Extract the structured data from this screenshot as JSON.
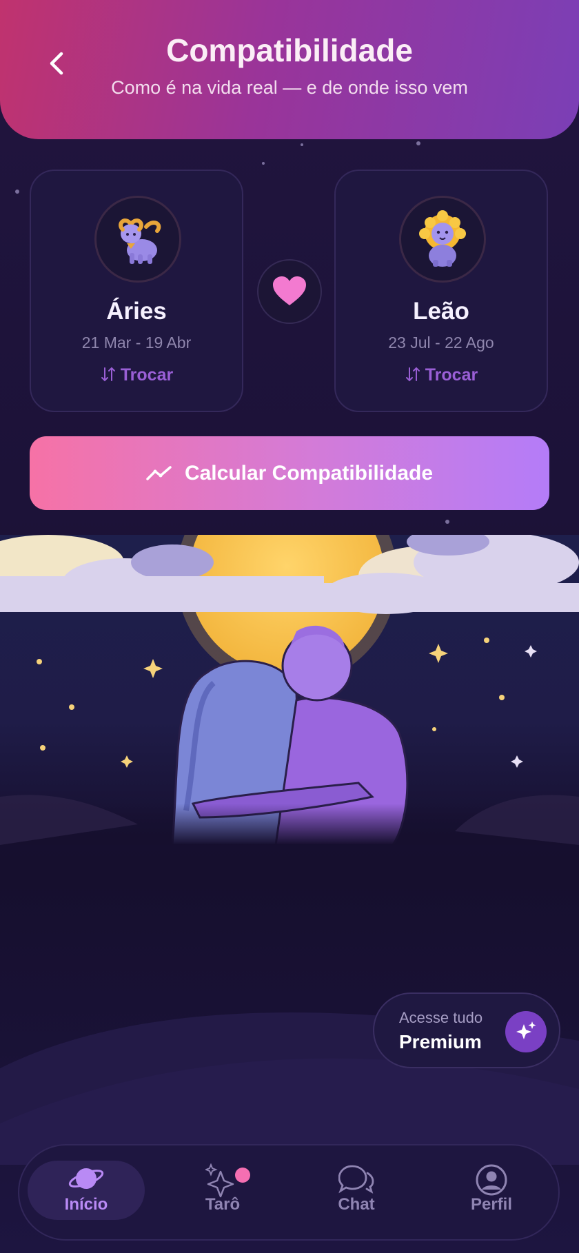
{
  "header": {
    "title": "Compatibilidade",
    "subtitle": "Como é na vida real — e de onde isso vem"
  },
  "signs": [
    {
      "name": "Áries",
      "dates": "21 Mar - 19 Abr",
      "swap_label": "Trocar",
      "icon": "ram-icon"
    },
    {
      "name": "Leão",
      "dates": "23 Jul - 22 Ago",
      "swap_label": "Trocar",
      "icon": "lion-icon"
    }
  ],
  "calculate_button": {
    "label": "Calcular Compatibilidade"
  },
  "premium": {
    "caption": "Acesse tudo",
    "label": "Premium"
  },
  "tabs": [
    {
      "label": "Início",
      "icon": "planet-icon",
      "active": true
    },
    {
      "label": "Tarô",
      "icon": "sparkles-icon",
      "badge": true
    },
    {
      "label": "Chat",
      "icon": "chat-bubbles-icon"
    },
    {
      "label": "Perfil",
      "icon": "profile-icon"
    }
  ],
  "colors": {
    "background": "#1c1238",
    "header_gradient_start": "#c0336e",
    "header_gradient_end": "#7b3fb6",
    "button_gradient_start": "#f672a6",
    "button_gradient_end": "#b47cf8",
    "accent": "#9a5fd6",
    "heart": "#f37ad0"
  }
}
